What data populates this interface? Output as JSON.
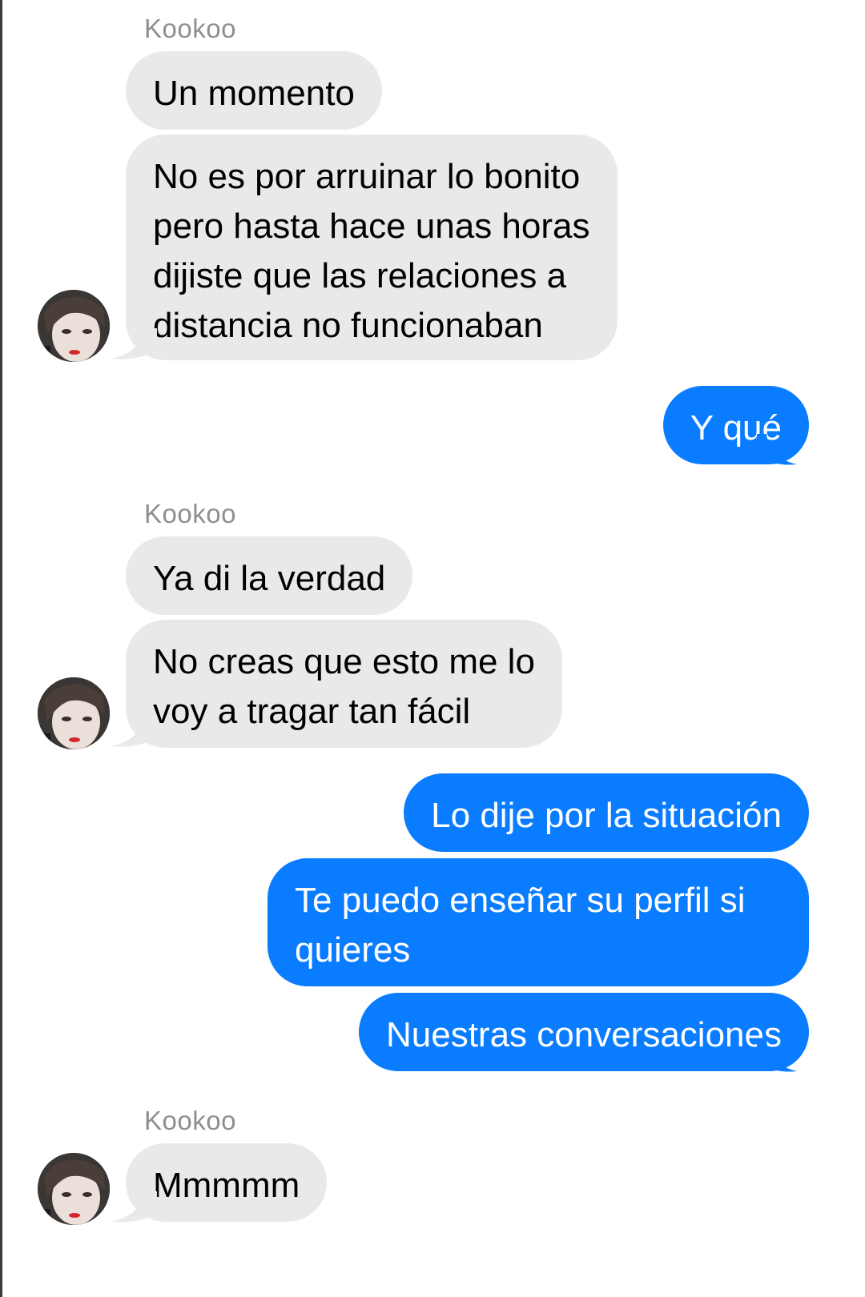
{
  "colors": {
    "incoming_bubble": "#e9e9eb",
    "outgoing_bubble": "#0a7cff",
    "sender_name": "#8e8e93"
  },
  "messages": [
    {
      "sender": "Kookoo"
    },
    {
      "text": "Un momento"
    },
    {
      "text": "No es por arruinar lo bonito\npero hasta hace unas horas\ndijiste que las relaciones a\ndistancia no funcionaban"
    },
    {
      "text": "Y qué"
    },
    {
      "sender": "Kookoo"
    },
    {
      "text": "Ya di la verdad"
    },
    {
      "text": "No creas que esto me lo\nvoy a tragar tan fácil"
    },
    {
      "text": "Lo dije por la situación"
    },
    {
      "text": "Te puedo enseñar su perfil si\nquieres"
    },
    {
      "text": "Nuestras conversaciones"
    },
    {
      "sender": "Kookoo"
    },
    {
      "text": "Mmmmm"
    }
  ],
  "icons": {
    "avatar": "contact-avatar-photo"
  }
}
